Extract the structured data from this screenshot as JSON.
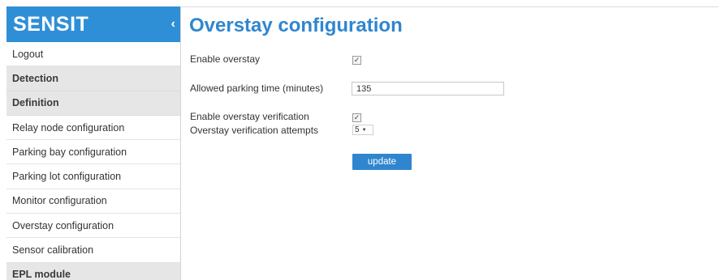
{
  "sidebar": {
    "brand": "SENSIT",
    "collapse_icon": "‹",
    "items": [
      {
        "label": "Logout",
        "group": false
      },
      {
        "label": "Detection",
        "group": true
      },
      {
        "label": "Definition",
        "group": true
      },
      {
        "label": "Relay node configuration",
        "group": false
      },
      {
        "label": "Parking bay configuration",
        "group": false
      },
      {
        "label": "Parking lot configuration",
        "group": false
      },
      {
        "label": "Monitor configuration",
        "group": false
      },
      {
        "label": "Overstay configuration",
        "group": false
      },
      {
        "label": "Sensor calibration",
        "group": false
      },
      {
        "label": "EPL module",
        "group": true
      }
    ]
  },
  "main": {
    "title": "Overstay configuration",
    "form": {
      "enable_overstay_label": "Enable overstay",
      "enable_overstay_checked": true,
      "allowed_time_label": "Allowed parking time (minutes)",
      "allowed_time_value": "135",
      "enable_verification_label": "Enable overstay verification",
      "enable_verification_checked": true,
      "attempts_label": "Overstay verification attempts",
      "attempts_value": "5",
      "update_label": "update"
    }
  },
  "colors": {
    "accent": "#2f86cf",
    "brand_bg": "#2f8fd6",
    "group_bg": "#e6e6e6"
  },
  "icons": {
    "collapse": "chevron-left-icon",
    "check": "checkmark-icon",
    "dropdown": "caret-down-icon"
  }
}
